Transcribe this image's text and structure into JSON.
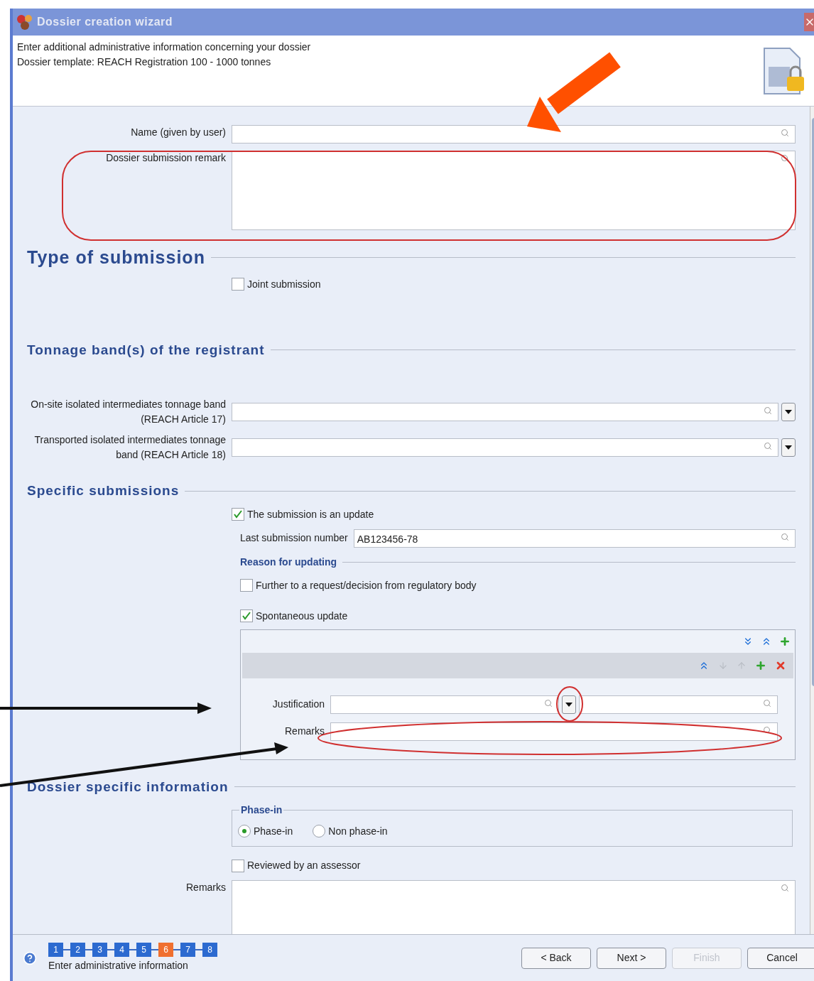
{
  "window": {
    "title": "Dossier creation wizard"
  },
  "header": {
    "lines": [
      "Enter additional administrative information concerning your dossier",
      "Dossier template: REACH Registration 100 - 1000 tonnes"
    ]
  },
  "general": {
    "name_field": {
      "label": "Name (given by user)"
    },
    "remark_field": {
      "label": "Dossier submission remark"
    }
  },
  "type_of_submission": {
    "heading": "Type of submission",
    "joint": {
      "label": "Joint submission",
      "checked": false
    }
  },
  "tonnage": {
    "heading": "Tonnage band(s) of the registrant",
    "fields": [
      {
        "label": "On-site isolated intermediates tonnage band (REACH Article 17)"
      },
      {
        "label": "Transported isolated intermediates tonnage band (REACH Article 18)"
      }
    ]
  },
  "specific": {
    "heading": "Specific submissions",
    "update": {
      "label": "The submission is an update",
      "checked": true
    },
    "last_number": {
      "label": "Last submission number",
      "value": "AB123456-78"
    },
    "reason_heading": "Reason for updating",
    "reasons": [
      {
        "label": "Further to a request/decision from regulatory body",
        "checked": false
      },
      {
        "label": "Spontaneous update",
        "checked": true
      }
    ],
    "block": {
      "justification_label": "Justification",
      "remarks_label": "Remarks"
    }
  },
  "dossier_specific": {
    "heading": "Dossier specific information",
    "phase_group": "Phase-in",
    "options": [
      {
        "label": "Phase-in",
        "selected": true
      },
      {
        "label": "Non phase-in",
        "selected": false
      }
    ],
    "reviewed": {
      "label": "Reviewed by an assessor",
      "checked": false
    },
    "remarks_label": "Remarks"
  },
  "footer": {
    "steps": [
      {
        "label": "1",
        "selected": false
      },
      {
        "label": "2",
        "selected": false
      },
      {
        "label": "3",
        "selected": false
      },
      {
        "label": "4",
        "selected": false
      },
      {
        "label": "5",
        "selected": false
      },
      {
        "label": "6",
        "selected": true
      },
      {
        "label": "7",
        "selected": false
      },
      {
        "label": "8",
        "selected": false
      }
    ],
    "caption": "Enter administrative information",
    "buttons": [
      {
        "label": "< Back",
        "disabled": false
      },
      {
        "label": "Next >",
        "disabled": false
      },
      {
        "label": "Finish",
        "disabled": true
      },
      {
        "label": "Cancel",
        "disabled": false
      }
    ]
  }
}
